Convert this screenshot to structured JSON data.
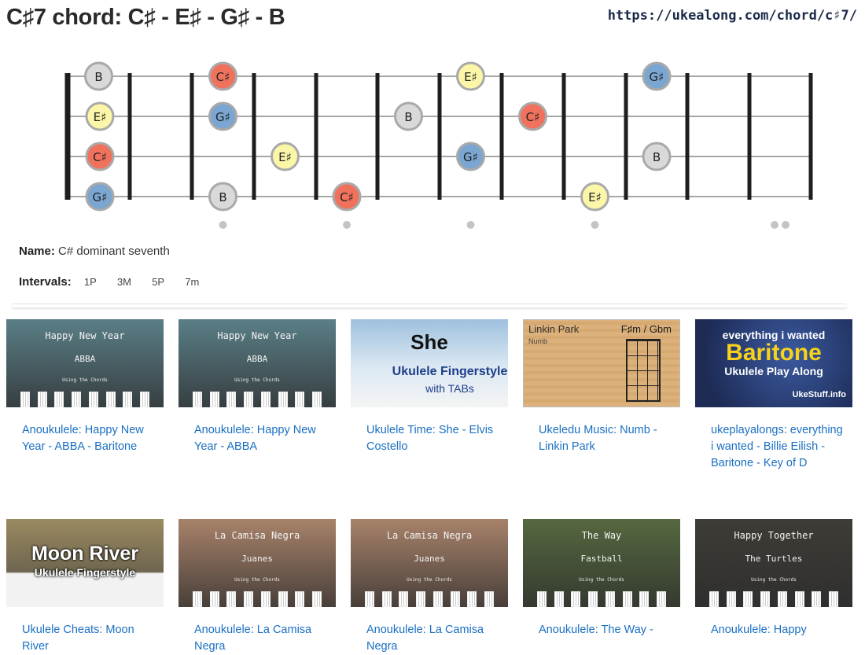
{
  "page": {
    "title": "C♯7 chord: C♯ - E♯ - G♯ - B",
    "url": "https://ukealong.com/chord/c♯7/"
  },
  "colors": {
    "C#": "#f0725d",
    "E#": "#fbf6a8",
    "G#": "#7aa6d1",
    "B": "#d9d9d9"
  },
  "fretboard": {
    "strings": [
      "A",
      "E",
      "C",
      "G"
    ],
    "notes": [
      {
        "string": 0,
        "fret": 1,
        "label": "B",
        "color_key": "B"
      },
      {
        "string": 0,
        "fret": 3,
        "label": "C♯",
        "color_key": "C#"
      },
      {
        "string": 0,
        "fret": 7,
        "label": "E♯",
        "color_key": "E#"
      },
      {
        "string": 0,
        "fret": 10,
        "label": "G♯",
        "color_key": "G#"
      },
      {
        "string": 1,
        "fret": 0,
        "label": "E♯",
        "color_key": "E#"
      },
      {
        "string": 1,
        "fret": 3,
        "label": "G♯",
        "color_key": "G#"
      },
      {
        "string": 1,
        "fret": 6,
        "label": "B",
        "color_key": "B"
      },
      {
        "string": 1,
        "fret": 8,
        "label": "C♯",
        "color_key": "C#"
      },
      {
        "string": 2,
        "fret": 0,
        "label": "C♯",
        "color_key": "C#"
      },
      {
        "string": 2,
        "fret": 4,
        "label": "E♯",
        "color_key": "E#"
      },
      {
        "string": 2,
        "fret": 7,
        "label": "G♯",
        "color_key": "G#"
      },
      {
        "string": 2,
        "fret": 10,
        "label": "B",
        "color_key": "B"
      },
      {
        "string": 3,
        "fret": 0,
        "label": "G♯",
        "color_key": "G#"
      },
      {
        "string": 3,
        "fret": 3,
        "label": "B",
        "color_key": "B"
      },
      {
        "string": 3,
        "fret": 5,
        "label": "C♯",
        "color_key": "C#"
      },
      {
        "string": 3,
        "fret": 9,
        "label": "E♯",
        "color_key": "E#"
      }
    ],
    "inlays_single": [
      3,
      5,
      7,
      9
    ],
    "inlays_double": [
      12
    ]
  },
  "info": {
    "name_label": "Name:",
    "name_value": "C# dominant seventh",
    "intervals_label": "Intervals:",
    "intervals": [
      "1P",
      "3M",
      "5P",
      "7m"
    ]
  },
  "videos": [
    {
      "title": "Anoukulele: Happy New Year - ABBA - Baritone",
      "thumb": {
        "style": "ribbon",
        "line1": "Happy New Year",
        "line2": "ABBA",
        "line3": "Using the Chords",
        "bg": "#5a7f87"
      }
    },
    {
      "title": "Anoukulele: Happy New Year - ABBA",
      "thumb": {
        "style": "ribbon",
        "line1": "Happy New Year",
        "line2": "ABBA",
        "line3": "Using the Chords",
        "bg": "#5a7f87"
      }
    },
    {
      "title": "Ukulele Time: She - Elvis Costello",
      "thumb": {
        "style": "she",
        "line1": "She",
        "line2": "Ukulele Fingerstyle",
        "line3": "with TABs",
        "bg": "#bcd3e6"
      }
    },
    {
      "title": "Ukeledu Music: Numb - Linkin Park",
      "thumb": {
        "style": "numb",
        "line1": "Linkin Park",
        "line2": "F♯m / Gbm",
        "line3": "Numb",
        "bg": "#deb47f"
      }
    },
    {
      "title": "ukeplayalongs: everything i wanted - Billie Eilish - Baritone - Key of D",
      "thumb": {
        "style": "baritone",
        "line1": "everything i wanted",
        "line2": "Baritone",
        "line3": "Ukulele Play Along",
        "line4": "UkeStuff.info",
        "bg": "#273b6e"
      }
    },
    {
      "title": "Ukulele Cheats: Moon River",
      "thumb": {
        "style": "moon",
        "line1": "Moon River",
        "line2": "Ukulele Fingerstyle",
        "bg": "#8f7a4e"
      }
    },
    {
      "title": "Anoukulele: La Camisa Negra",
      "thumb": {
        "style": "ribbon",
        "line1": "La Camisa Negra",
        "line2": "Juanes",
        "line3": "Using the Chords",
        "bg": "#a8826a"
      }
    },
    {
      "title": "Anoukulele: La Camisa Negra",
      "thumb": {
        "style": "ribbon",
        "line1": "La Camisa Negra",
        "line2": "Juanes",
        "line3": "Using the Chords",
        "bg": "#a8826a"
      }
    },
    {
      "title": "Anoukulele: The Way -",
      "thumb": {
        "style": "ribbon",
        "line1": "The Way",
        "line2": "Fastball",
        "line3": "Using the Chords",
        "bg": "#55683f"
      }
    },
    {
      "title": "Anoukulele: Happy",
      "thumb": {
        "style": "ribbon",
        "line1": "Happy Together",
        "line2": "The Turtles",
        "line3": "Using the Chords",
        "bg": "#3e3c36"
      }
    }
  ]
}
